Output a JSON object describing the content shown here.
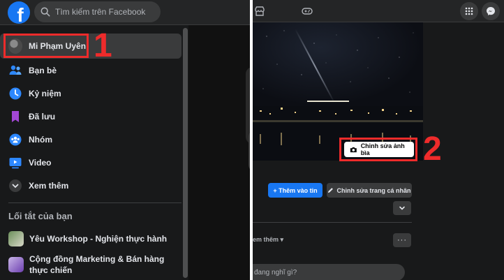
{
  "left": {
    "search": {
      "placeholder": "Tìm kiếm trên Facebook"
    },
    "profile": {
      "name": "Mi Phạm Uyên"
    },
    "menu": [
      {
        "label": "Bạn bè",
        "icon": "friends-icon"
      },
      {
        "label": "Kỷ niệm",
        "icon": "memories-icon"
      },
      {
        "label": "Đã lưu",
        "icon": "saved-icon"
      },
      {
        "label": "Nhóm",
        "icon": "groups-icon"
      },
      {
        "label": "Video",
        "icon": "video-icon"
      },
      {
        "label": "Xem thêm",
        "icon": "chevron-down-icon"
      }
    ],
    "shortcuts_title": "Lối tắt của bạn",
    "shortcuts": [
      {
        "label": "Yêu Workshop - Nghiện thực hành"
      },
      {
        "label": "Cộng đồng Marketing & Bán hàng thực chiến"
      }
    ],
    "annotation": "1"
  },
  "right": {
    "edit_cover_label": "Chỉnh sửa ảnh bìa",
    "add_story_label": "+ Thêm vào tin",
    "edit_profile_label": "Chỉnh sửa trang cá nhân",
    "see_more_label": "em thêm ▾",
    "more_label": "···",
    "composer_placeholder": "đang nghĩ gì?",
    "annotation": "2"
  },
  "colors": {
    "facebook_blue": "#1877f2",
    "annotation_red": "#ee2b2b",
    "dark_bg": "#18191a"
  }
}
